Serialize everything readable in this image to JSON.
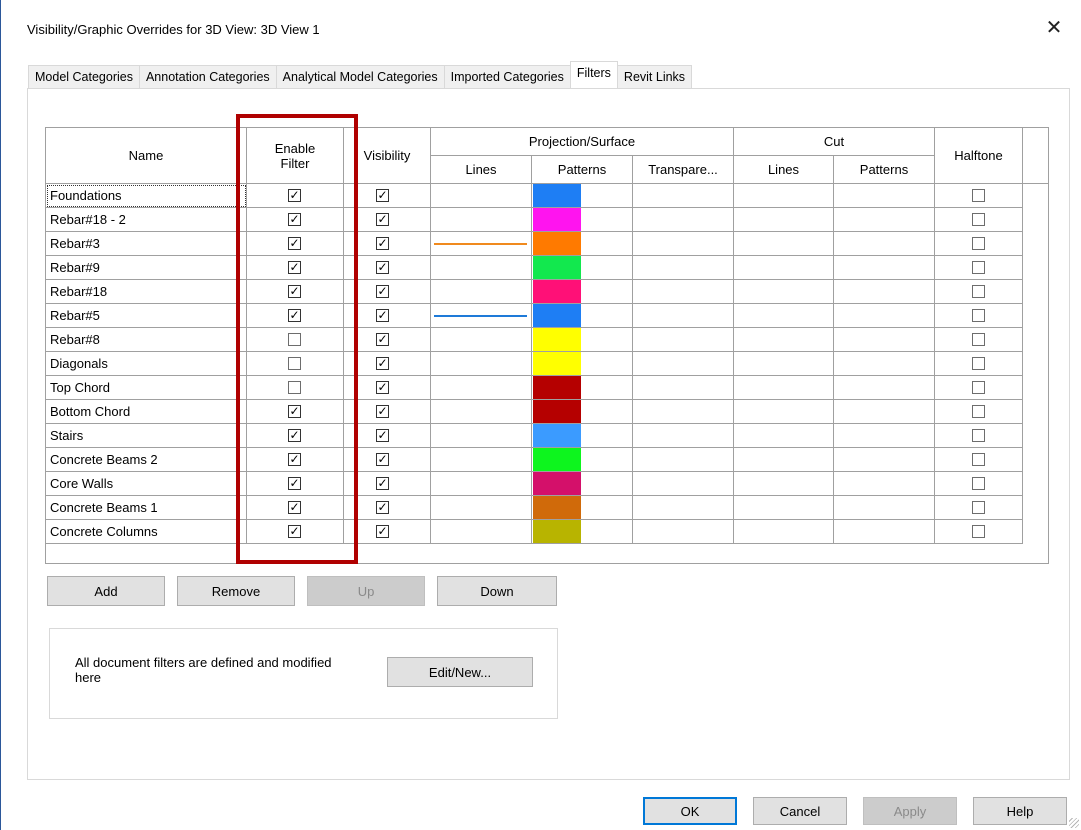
{
  "window": {
    "title": "Visibility/Graphic Overrides for 3D View: 3D View 1",
    "close_glyph": "✕"
  },
  "tabs": [
    {
      "label": "Model Categories",
      "active": false
    },
    {
      "label": "Annotation Categories",
      "active": false
    },
    {
      "label": "Analytical Model Categories",
      "active": false
    },
    {
      "label": "Imported Categories",
      "active": false
    },
    {
      "label": "Filters",
      "active": true
    },
    {
      "label": "Revit Links",
      "active": false
    }
  ],
  "table": {
    "headers": {
      "name": "Name",
      "enable_filter": "Enable Filter",
      "visibility": "Visibility",
      "projection_surface": "Projection/Surface",
      "proj_lines": "Lines",
      "proj_patterns": "Patterns",
      "proj_transparency": "Transpare...",
      "cut": "Cut",
      "cut_lines": "Lines",
      "cut_patterns": "Patterns",
      "halftone": "Halftone"
    },
    "rows": [
      {
        "name": "Foundations",
        "enable": true,
        "visible": true,
        "line_color": "",
        "pattern_color": "#1e7ef4",
        "halftone": false
      },
      {
        "name": "Rebar#18 - 2",
        "enable": true,
        "visible": true,
        "line_color": "",
        "pattern_color": "#ff14ef",
        "halftone": false
      },
      {
        "name": "Rebar#3",
        "enable": true,
        "visible": true,
        "line_color": "#f08a1e",
        "pattern_color": "#ff7a00",
        "halftone": false
      },
      {
        "name": "Rebar#9",
        "enable": true,
        "visible": true,
        "line_color": "",
        "pattern_color": "#12e84e",
        "halftone": false
      },
      {
        "name": "Rebar#18",
        "enable": true,
        "visible": true,
        "line_color": "",
        "pattern_color": "#ff1077",
        "halftone": false
      },
      {
        "name": "Rebar#5",
        "enable": true,
        "visible": true,
        "line_color": "#1e7ad8",
        "pattern_color": "#1e7ef4",
        "halftone": false
      },
      {
        "name": "Rebar#8",
        "enable": false,
        "visible": true,
        "line_color": "",
        "pattern_color": "#ffff00",
        "halftone": false
      },
      {
        "name": "Diagonals",
        "enable": false,
        "visible": true,
        "line_color": "",
        "pattern_color": "#ffff00",
        "halftone": false
      },
      {
        "name": "Top Chord",
        "enable": false,
        "visible": true,
        "line_color": "",
        "pattern_color": "#b50000",
        "halftone": false
      },
      {
        "name": "Bottom Chord",
        "enable": true,
        "visible": true,
        "line_color": "",
        "pattern_color": "#b50000",
        "halftone": false
      },
      {
        "name": "Stairs",
        "enable": true,
        "visible": true,
        "line_color": "",
        "pattern_color": "#3b9bff",
        "halftone": false
      },
      {
        "name": "Concrete Beams 2",
        "enable": true,
        "visible": true,
        "line_color": "",
        "pattern_color": "#0df51e",
        "halftone": false
      },
      {
        "name": "Core Walls",
        "enable": true,
        "visible": true,
        "line_color": "",
        "pattern_color": "#d4106a",
        "halftone": false
      },
      {
        "name": "Concrete Beams 1",
        "enable": true,
        "visible": true,
        "line_color": "",
        "pattern_color": "#d06a0a",
        "halftone": false
      },
      {
        "name": "Concrete Columns",
        "enable": true,
        "visible": true,
        "line_color": "",
        "pattern_color": "#b8b400",
        "halftone": false
      }
    ]
  },
  "buttons": {
    "add": "Add",
    "remove": "Remove",
    "up": "Up",
    "down": "Down",
    "edit_new": "Edit/New...",
    "ok": "OK",
    "cancel": "Cancel",
    "apply": "Apply",
    "help": "Help"
  },
  "info": {
    "text": "All document filters are defined and modified here"
  },
  "colors": {
    "highlight_box": "#b00000",
    "focus_border": "#0078d7"
  }
}
